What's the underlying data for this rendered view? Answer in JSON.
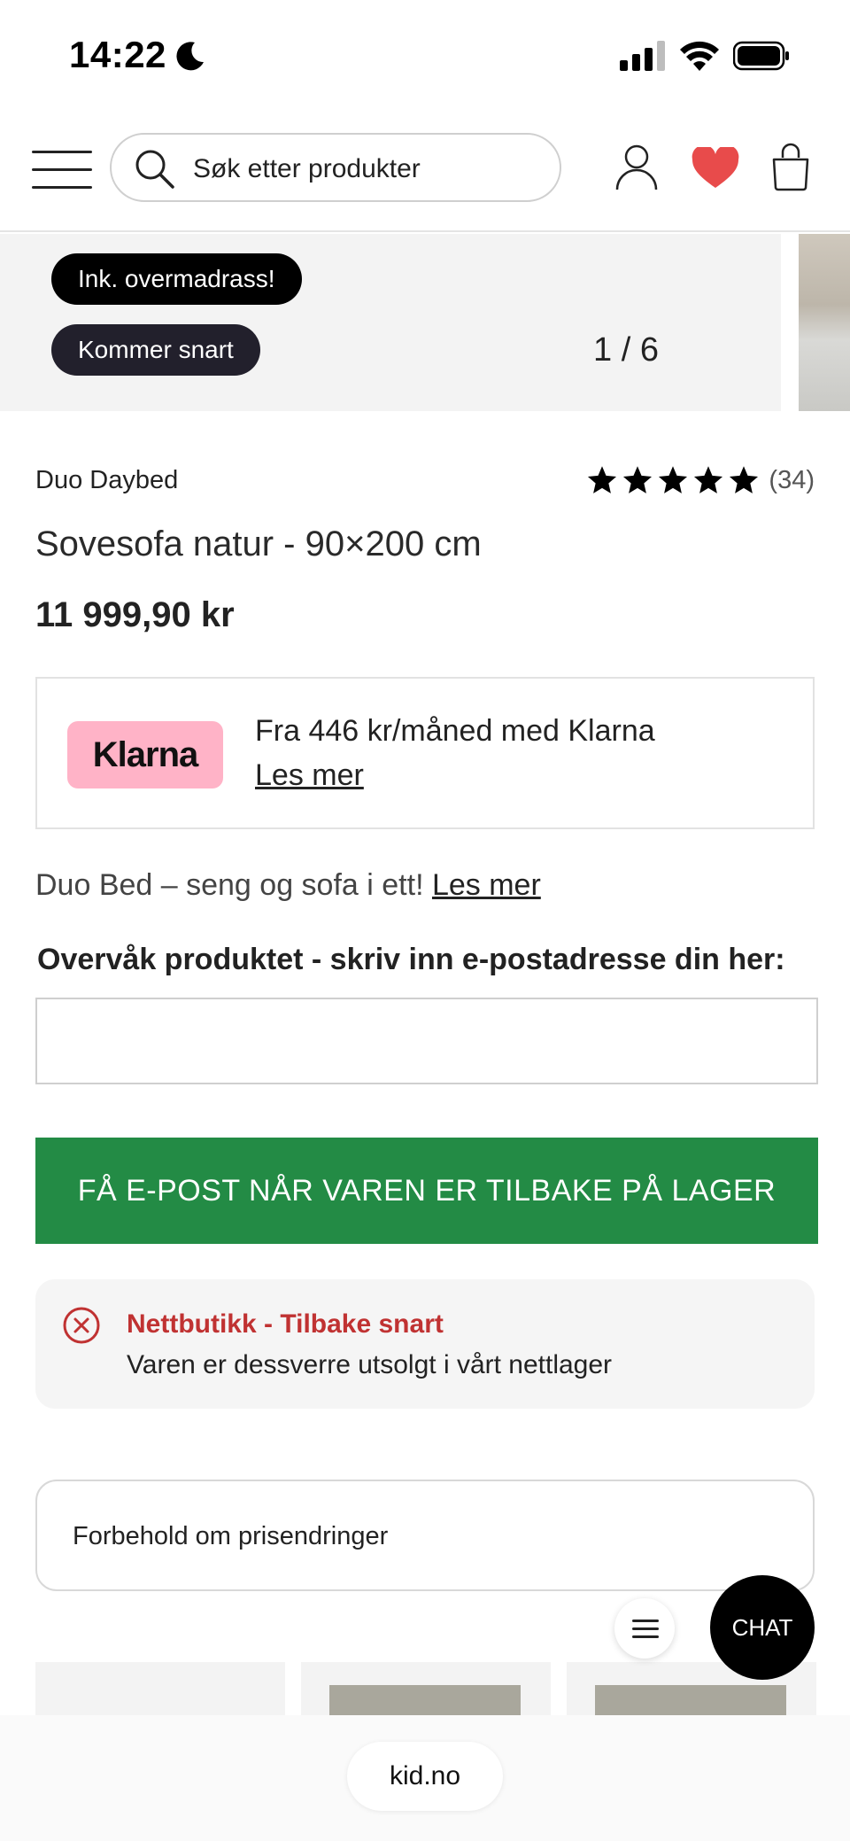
{
  "status_bar": {
    "time": "14:22",
    "icons": [
      "moon-icon",
      "cellular-signal-icon",
      "wifi-icon",
      "battery-icon"
    ]
  },
  "header": {
    "search_placeholder": "Søk etter produkter",
    "icons": [
      "hamburger-menu-icon",
      "search-icon",
      "user-icon",
      "heart-icon",
      "cart-icon"
    ],
    "heart_color": "#e84b4b"
  },
  "gallery": {
    "badges": [
      "Ink. overmadrass!",
      "Kommer snart"
    ],
    "counter": "1 / 6"
  },
  "product": {
    "brand": "Duo Daybed",
    "rating": 5,
    "rating_count": "(34)",
    "title": "Sovesofa natur - 90×200 cm",
    "price": "11 999,90 kr"
  },
  "klarna": {
    "logo_text": "Klarna",
    "text": "Fra 446 kr/måned med Klarna",
    "link": "Les mer",
    "logo_color": "#ffb3c7"
  },
  "description": {
    "text": "Duo Bed – seng og sofa i ett!",
    "link": "Les mer"
  },
  "watch": {
    "label": "Overvåk produktet - skriv inn e-postadresse din her:",
    "email_value": "",
    "button": "FÅ E-POST NÅR VAREN ER TILBAKE PÅ LAGER",
    "button_color": "#238b45"
  },
  "stock": {
    "title": "Nettbutikk - Tilbake snart",
    "text": "Varen er dessverre utsolgt i vårt nettlager",
    "status_color": "#c03232"
  },
  "disclaimer": {
    "label": "Forbehold om prisendringer"
  },
  "fabs": {
    "chat": "CHAT"
  },
  "browser": {
    "url": "kid.no"
  }
}
